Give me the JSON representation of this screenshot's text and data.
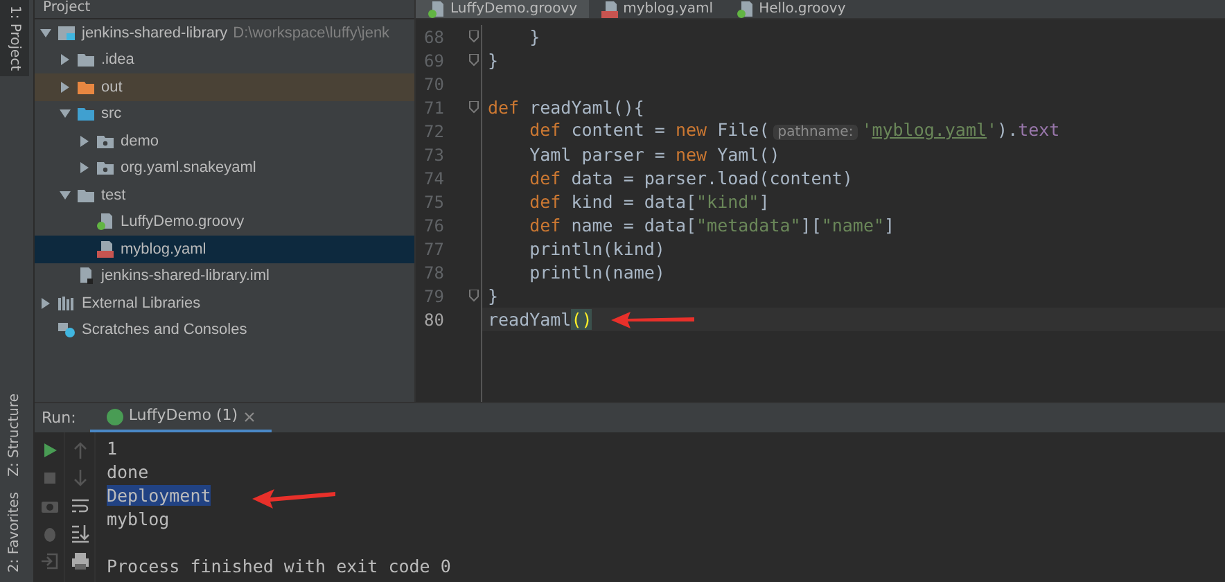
{
  "tool_strip": {
    "top": [
      {
        "label": "1: Project",
        "selected": true
      }
    ],
    "bottom": [
      {
        "label": "Z: Structure",
        "selected": false
      },
      {
        "label": "2: Favorites",
        "selected": false
      }
    ]
  },
  "project": {
    "title": "Project",
    "tree": [
      {
        "label": "jenkins-shared-library",
        "path": "D:\\workspace\\luffy\\jenk",
        "kind": "module",
        "expanded": true,
        "selected": false,
        "children": [
          {
            "label": ".idea",
            "kind": "folder",
            "expanded": false,
            "selected": false
          },
          {
            "label": "out",
            "kind": "excluded",
            "expanded": false,
            "selected": false
          },
          {
            "label": "src",
            "kind": "source",
            "expanded": true,
            "selected": false,
            "children": [
              {
                "label": "demo",
                "kind": "package",
                "expanded": false,
                "selected": false
              },
              {
                "label": "org.yaml.snakeyaml",
                "kind": "package",
                "expanded": false,
                "selected": false
              }
            ]
          },
          {
            "label": "test",
            "kind": "folder",
            "expanded": true,
            "selected": false,
            "children": [
              {
                "label": "LuffyDemo.groovy",
                "kind": "groovy",
                "selected": false
              },
              {
                "label": "myblog.yaml",
                "kind": "yaml",
                "selected": true
              }
            ]
          },
          {
            "label": "jenkins-shared-library.iml",
            "kind": "iml",
            "selected": false
          }
        ]
      },
      {
        "label": "External Libraries",
        "kind": "libraries",
        "expanded": false,
        "selected": false
      },
      {
        "label": "Scratches and Consoles",
        "kind": "scratches",
        "selected": false
      }
    ]
  },
  "editor": {
    "tabs": [
      {
        "label": "LuffyDemo.groovy",
        "kind": "groovy",
        "selected": true
      },
      {
        "label": "myblog.yaml",
        "kind": "yaml",
        "selected": false
      },
      {
        "label": "Hello.groovy",
        "kind": "groovy",
        "selected": false
      }
    ],
    "lines": [
      {
        "number": "68",
        "fold": true,
        "current": false,
        "tokens": [
          {
            "text": "    }",
            "kind": "plain"
          }
        ]
      },
      {
        "number": "69",
        "fold": true,
        "current": false,
        "tokens": [
          {
            "text": "}",
            "kind": "plain"
          }
        ]
      },
      {
        "number": "70",
        "fold": false,
        "current": false
      },
      {
        "number": "71",
        "fold": true,
        "current": false,
        "tokens": [
          {
            "text": "def",
            "kind": "keyword"
          },
          {
            "text": " readYaml(){",
            "kind": "plain"
          }
        ]
      },
      {
        "number": "72",
        "fold": false,
        "current": false,
        "tokens": [
          {
            "text": "    def",
            "kind": "keyword"
          },
          {
            "text": " content = ",
            "kind": "plain"
          },
          {
            "text": "new",
            "kind": "keyword"
          },
          {
            "text": " File(",
            "kind": "plain"
          },
          {
            "text": "pathname:",
            "kind": "hint"
          },
          {
            "text": "'",
            "kind": "string"
          },
          {
            "text": "myblog.yaml",
            "kind": "link"
          },
          {
            "text": "'",
            "kind": "string"
          },
          {
            "text": ").",
            "kind": "plain"
          },
          {
            "text": "text",
            "kind": "field"
          }
        ]
      },
      {
        "number": "73",
        "fold": false,
        "current": false,
        "tokens": [
          {
            "text": "    Yaml parser = ",
            "kind": "plain"
          },
          {
            "text": "new",
            "kind": "keyword"
          },
          {
            "text": " Yaml()",
            "kind": "plain"
          }
        ]
      },
      {
        "number": "74",
        "fold": false,
        "current": false,
        "tokens": [
          {
            "text": "    def",
            "kind": "keyword"
          },
          {
            "text": " data = parser.load(content)",
            "kind": "plain"
          }
        ]
      },
      {
        "number": "75",
        "fold": false,
        "current": false,
        "tokens": [
          {
            "text": "    def",
            "kind": "keyword"
          },
          {
            "text": " kind = data[",
            "kind": "plain"
          },
          {
            "text": "\"kind\"",
            "kind": "string"
          },
          {
            "text": "]",
            "kind": "plain"
          }
        ]
      },
      {
        "number": "76",
        "fold": false,
        "current": false,
        "tokens": [
          {
            "text": "    def",
            "kind": "keyword"
          },
          {
            "text": " name = data[",
            "kind": "plain"
          },
          {
            "text": "\"metadata\"",
            "kind": "string"
          },
          {
            "text": "][",
            "kind": "plain"
          },
          {
            "text": "\"name\"",
            "kind": "string"
          },
          {
            "text": "]",
            "kind": "plain"
          }
        ]
      },
      {
        "number": "77",
        "fold": false,
        "current": false,
        "tokens": [
          {
            "text": "    println(kind)",
            "kind": "plain"
          }
        ]
      },
      {
        "number": "78",
        "fold": false,
        "current": false,
        "tokens": [
          {
            "text": "    println(name)",
            "kind": "plain"
          }
        ]
      },
      {
        "number": "79",
        "fold": true,
        "current": false,
        "tokens": [
          {
            "text": "}",
            "kind": "plain"
          }
        ]
      },
      {
        "number": "80",
        "fold": false,
        "current": true,
        "tokens": [
          {
            "text": "readYaml",
            "kind": "plain"
          },
          {
            "text": "()",
            "kind": "bracket"
          }
        ]
      }
    ]
  },
  "run": {
    "label": "Run:",
    "tabs": [
      {
        "label": "LuffyDemo (1)",
        "selected": true
      }
    ],
    "output": [
      {
        "text": "1",
        "selected": false
      },
      {
        "text": "done",
        "selected": false
      },
      {
        "text": "Deployment",
        "selected": true
      },
      {
        "text": "myblog",
        "selected": false
      },
      {
        "selected": false
      },
      {
        "text": "Process finished with exit code 0",
        "selected": false
      }
    ]
  }
}
